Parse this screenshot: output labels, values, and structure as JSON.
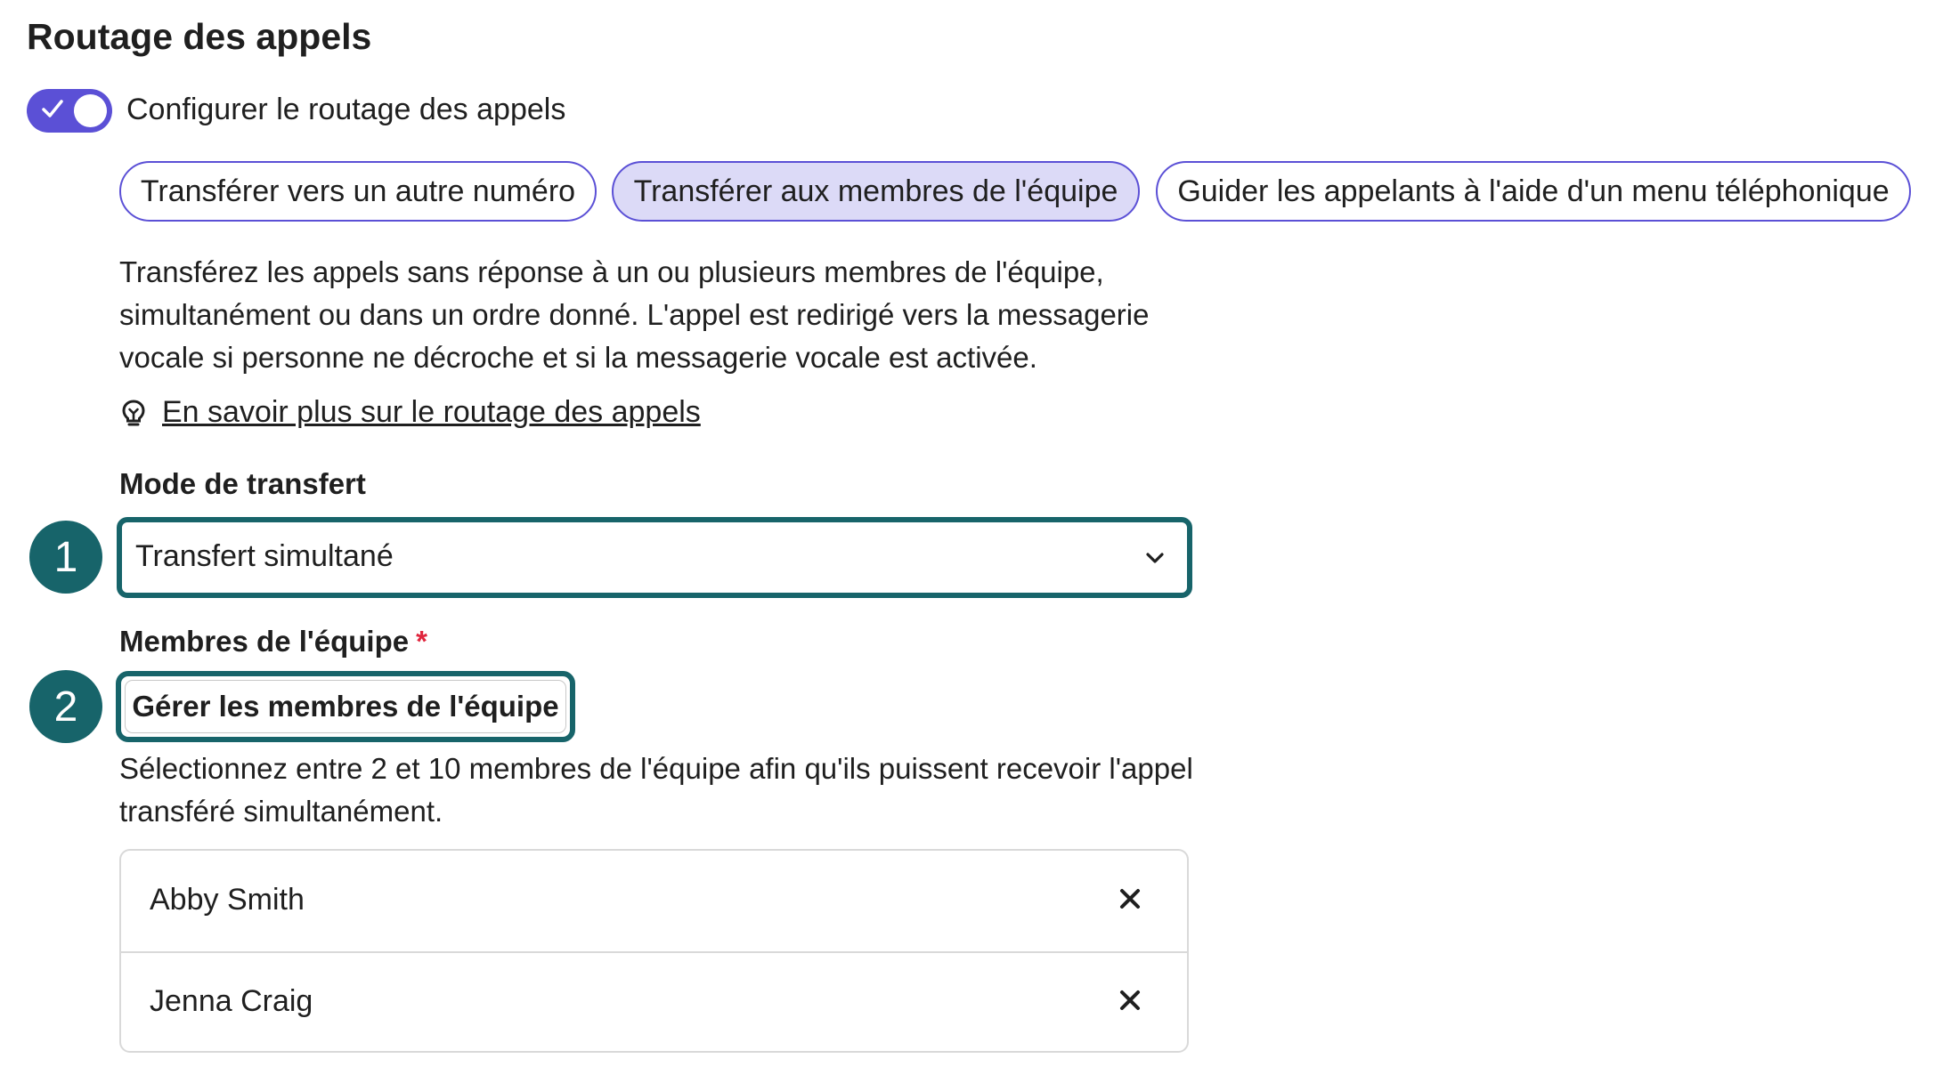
{
  "section": {
    "title": "Routage des appels"
  },
  "routing_toggle": {
    "label": "Configurer le routage des appels",
    "enabled": true
  },
  "routing_options": [
    {
      "label": "Transférer vers un autre numéro",
      "selected": false
    },
    {
      "label": "Transférer aux membres de l'équipe",
      "selected": true
    },
    {
      "label": "Guider les appelants à l'aide d'un menu téléphonique",
      "selected": false
    }
  ],
  "description": "Transférez les appels sans réponse à un ou plusieurs membres de l'équipe, simultanément ou dans un ordre donné. L'appel est redirigé vers la messagerie vocale si personne ne décroche et si la messagerie vocale est activée.",
  "learn_more": {
    "icon": "lightbulb-icon",
    "label": "En savoir plus sur le routage des appels"
  },
  "transfer_mode": {
    "label": "Mode de transfert",
    "value": "Transfert simultané",
    "step_badge": "1"
  },
  "team_members": {
    "label": "Membres de l'équipe",
    "required_marker": "*",
    "manage_button": "Gérer les membres de l'équipe",
    "step_badge": "2",
    "hint": "Sélectionnez entre 2 et 10 membres de l'équipe afin qu'ils puissent recevoir l'appel transféré simultanément.",
    "members": [
      {
        "name": "Abby Smith"
      },
      {
        "name": "Jenna Craig"
      }
    ]
  },
  "colors": {
    "accent": "#5b50d6",
    "selected_pill_bg": "#dcdaf7",
    "focus_teal": "#17646a",
    "required_red": "#e0263e"
  }
}
